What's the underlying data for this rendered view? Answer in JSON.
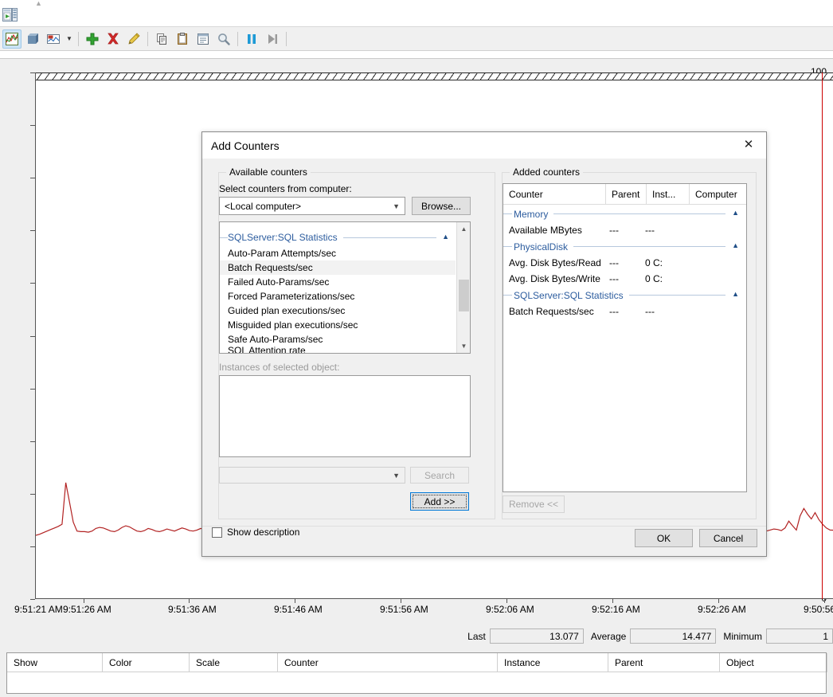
{
  "window": {
    "app_icon": "performance-monitor-icon"
  },
  "toolbar": {
    "buttons": [
      {
        "name": "view-graph",
        "icon": "line-graph-icon",
        "selected": true
      },
      {
        "name": "view-histogram",
        "icon": "histogram-bar-icon",
        "selected": false
      },
      {
        "name": "change-graph-type",
        "icon": "change-graph-type-icon",
        "selected": false
      },
      {
        "name": "change-graph-type-dropdown",
        "icon": "chevron-down-icon",
        "selected": false
      },
      {
        "name": "add-counter",
        "icon": "green-plus-icon",
        "selected": false
      },
      {
        "name": "delete-counter",
        "icon": "red-x-icon",
        "selected": false
      },
      {
        "name": "highlight",
        "icon": "highlighter-pencil-icon",
        "selected": false
      },
      {
        "name": "copy-properties",
        "icon": "copy-icon",
        "selected": false
      },
      {
        "name": "paste-counter-list",
        "icon": "clipboard-paste-icon",
        "selected": false
      },
      {
        "name": "properties",
        "icon": "properties-window-icon",
        "selected": false
      },
      {
        "name": "zoom-to",
        "icon": "magnifier-icon",
        "selected": false
      },
      {
        "name": "freeze-display",
        "icon": "pause-icon",
        "selected": false
      },
      {
        "name": "update-data",
        "icon": "step-forward-icon",
        "selected": false
      }
    ]
  },
  "chart_data": {
    "type": "line",
    "title": "",
    "xlabel": "",
    "ylabel": "",
    "ylim": [
      0,
      100
    ],
    "y_ticks": [
      0,
      10,
      20,
      30,
      40,
      50,
      60,
      70,
      80,
      90,
      100
    ],
    "x_tick_labels": [
      "9:51:21 AM",
      "9:51:26 AM",
      "9:51:36 AM",
      "9:51:46 AM",
      "9:51:56 AM",
      "9:52:06 AM",
      "9:52:16 AM",
      "9:52:26 AM",
      "9:50:56"
    ],
    "grid": false,
    "legend_position": "bottom",
    "series": [
      {
        "name": "Batch Requests/sec",
        "color": "#b22222",
        "values": [
          12.1,
          12.3,
          12.6,
          12.9,
          13.2,
          13.5,
          13.8,
          14.2,
          22.1,
          18.4,
          14.6,
          12.9,
          12.8,
          12.8,
          12.7,
          12.9,
          13.4,
          13.6,
          13.5,
          13.2,
          12.9,
          12.8,
          13.1,
          13.6,
          13.9,
          13.7,
          13.3,
          12.9,
          12.8,
          13.0,
          13.4,
          13.2,
          12.9,
          12.8,
          13.0,
          13.3,
          13.1,
          12.9,
          13.2,
          13.5,
          13.3,
          13.0,
          12.9,
          13.1,
          13.4,
          13.2,
          13.0,
          13.3,
          13.6,
          13.4,
          13.1,
          12.9,
          13.0,
          13.2,
          13.5,
          13.3,
          13.0,
          12.9,
          13.1,
          13.4,
          13.2,
          12.9,
          13.0,
          13.3,
          13.6,
          13.4,
          13.1,
          12.9,
          13.0,
          13.2,
          13.5,
          13.3,
          13.0,
          12.9,
          13.1,
          13.4,
          13.2,
          12.9,
          13.0,
          13.3,
          13.5,
          13.3,
          13.0,
          12.9,
          13.1,
          13.4,
          13.2,
          13.0,
          12.9,
          13.2,
          13.6,
          13.3,
          13.0,
          12.9,
          13.1,
          13.3,
          13.1,
          12.9,
          13.0,
          13.2,
          13.5,
          13.2,
          12.9,
          13.0,
          13.3,
          13.5,
          13.2,
          13.0,
          12.9,
          13.1,
          13.4,
          13.2,
          12.9,
          13.0,
          13.3,
          13.6,
          13.3,
          13.0,
          12.9,
          13.1,
          13.3,
          13.1,
          12.9,
          13.0,
          13.2,
          13.4,
          13.2,
          13.0,
          12.9,
          13.1,
          13.3,
          13.5,
          13.2,
          13.0,
          12.9,
          13.1,
          13.4,
          13.2,
          12.9,
          13.0,
          13.2,
          13.5,
          13.3,
          13.0,
          12.9,
          13.1,
          13.3,
          13.1,
          12.9,
          13.0,
          13.2,
          13.5,
          13.2,
          13.0,
          12.9,
          13.1,
          13.4,
          13.2,
          13.0,
          12.9,
          13.1,
          13.3,
          13.1,
          12.9,
          13.0,
          13.2,
          13.4,
          13.2,
          13.0,
          12.9,
          13.1,
          13.3,
          13.5,
          13.2,
          13.0,
          12.9,
          13.1,
          13.3,
          13.1,
          12.9,
          13.0,
          13.2,
          13.4,
          13.2,
          13.0,
          12.9,
          13.1,
          13.3,
          13.1,
          12.9,
          13.0,
          13.2,
          13.4,
          13.2,
          13.0,
          12.9,
          13.1,
          13.3,
          13.2,
          13.0,
          13.5,
          14.8,
          13.9,
          13.1,
          15.8,
          17.2,
          16.1,
          15.2,
          16.4,
          15.1,
          14.2,
          13.5,
          13.1,
          13.077
        ]
      }
    ],
    "time_cursor_position": 0.985
  },
  "value_bar": {
    "fields": [
      {
        "label": "Last",
        "value": "13.077"
      },
      {
        "label": "Average",
        "value": "14.477"
      },
      {
        "label": "Minimum",
        "value": "1"
      }
    ]
  },
  "legend": {
    "columns": [
      "Show",
      "Color",
      "Scale",
      "Counter",
      "Instance",
      "Parent",
      "Object"
    ],
    "rows": []
  },
  "dialog": {
    "title": "Add Counters",
    "close_label": "✕",
    "available": {
      "caption": "Available counters",
      "select_from_label": "Select counters from computer:",
      "computer_value": "<Local computer>",
      "browse_label": "Browse...",
      "tree": {
        "group": "SQLServer:SQL Statistics",
        "items": [
          "Auto-Param Attempts/sec",
          "Batch Requests/sec",
          "Failed Auto-Params/sec",
          "Forced Parameterizations/sec",
          "Guided plan executions/sec",
          "Misguided plan executions/sec",
          "Safe Auto-Params/sec"
        ],
        "selected_item": "Batch Requests/sec",
        "partial_item": "SQL Attention rate"
      },
      "instances_label": "Instances of selected object:",
      "instances_items": [],
      "search_combo_value": "",
      "search_label": "Search",
      "add_label": "Add >>"
    },
    "added": {
      "caption": "Added counters",
      "columns": [
        "Counter",
        "Parent",
        "Inst...",
        "Computer"
      ],
      "groups": [
        {
          "name": "Memory",
          "rows": [
            {
              "counter": "Available MBytes",
              "parent": "---",
              "instance": "---",
              "computer": ""
            }
          ]
        },
        {
          "name": "PhysicalDisk",
          "rows": [
            {
              "counter": "Avg. Disk Bytes/Read",
              "parent": "---",
              "instance": "0 C:",
              "computer": ""
            },
            {
              "counter": "Avg. Disk Bytes/Write",
              "parent": "---",
              "instance": "0 C:",
              "computer": ""
            }
          ]
        },
        {
          "name": "SQLServer:SQL Statistics",
          "rows": [
            {
              "counter": "Batch Requests/sec",
              "parent": "---",
              "instance": "---",
              "computer": ""
            }
          ]
        }
      ],
      "remove_label": "Remove <<"
    },
    "show_description_label": "Show description",
    "show_description_checked": false,
    "ok_label": "OK",
    "cancel_label": "Cancel"
  },
  "colors": {
    "series": "#b22222",
    "time_cursor": "#cc0000",
    "group_header": "#2c5c9e",
    "accent": "#0078d7"
  }
}
